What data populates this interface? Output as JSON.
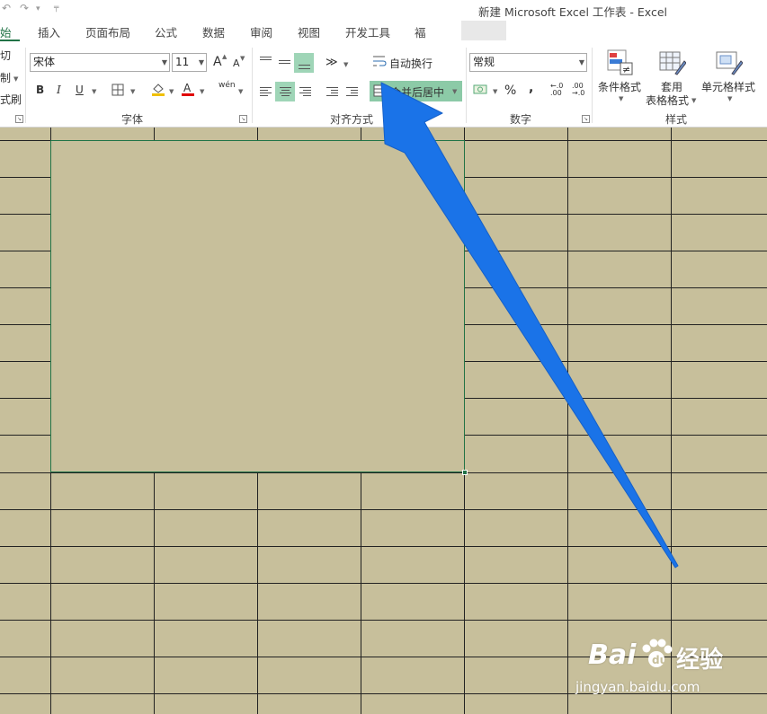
{
  "window": {
    "title": "新建 Microsoft Excel 工作表 - Excel",
    "qat_undo": "↶",
    "qat_redo": "↷",
    "qat_more": "╤"
  },
  "tabs": [
    {
      "label": "始",
      "active": true
    },
    {
      "label": "插入"
    },
    {
      "label": "页面布局"
    },
    {
      "label": "公式"
    },
    {
      "label": "数据"
    },
    {
      "label": "审阅"
    },
    {
      "label": "视图"
    },
    {
      "label": "开发工具"
    },
    {
      "label": "褔"
    }
  ],
  "clipboard": {
    "cut_fragment": "切",
    "copy_fragment": "制",
    "painter_fragment": "式刷"
  },
  "font": {
    "name": "宋体",
    "size": "11",
    "grow": "A",
    "shrink": "A",
    "bold": "B",
    "italic": "I",
    "underline": "U",
    "phonetic": "wén",
    "group_label": "字体"
  },
  "alignment": {
    "wrap_text": "自动换行",
    "merge_center": "合并后居中",
    "group_label": "对齐方式"
  },
  "number": {
    "format": "常规",
    "percent": "%",
    "comma": ",",
    "group_label": "数字"
  },
  "styles": {
    "conditional_format": "条件格式",
    "table_format_line1": "套用",
    "table_format_line2": "表格格式",
    "cell_styles": "单元格样式",
    "group_label": "样式"
  },
  "colors": {
    "accent": "#217346",
    "highlight": "#9fd5b7",
    "sheet_fill": "#c7bf9b",
    "arrow": "#1a73e8"
  },
  "watermark": {
    "brand": "Bai",
    "brand_tail": "经验",
    "url": "jingyan.baidu.com"
  }
}
